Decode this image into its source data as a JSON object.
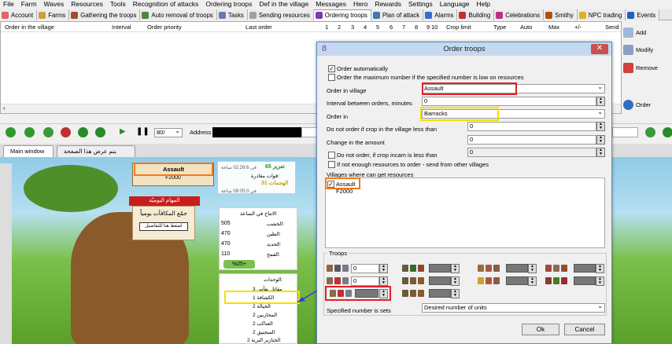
{
  "menu": [
    "File",
    "Farm",
    "Waves",
    "Resources",
    "Tools",
    "Recognition of attacks",
    "Ordering troops",
    "Def in the village",
    "Messages",
    "Hero",
    "Rewards",
    "Settings",
    "Language",
    "Help"
  ],
  "tabs": [
    "Account",
    "Farms",
    "Gathering the troops",
    "Auto removal of troops",
    "Tasks",
    "Sending resources",
    "Ordering troops",
    "Plan of attack",
    "Alarms",
    "Building",
    "Celebrations",
    "Smithy",
    "NPC trading",
    "Events"
  ],
  "orders_table": {
    "columns": [
      "Order in the village",
      "Interval",
      "Order priority",
      "Last order",
      "1",
      "2",
      "3",
      "4",
      "5",
      "6",
      "7",
      "8",
      "9",
      "10",
      "Crop limit",
      "Type",
      "Auto",
      "Max",
      "+/-",
      "Send"
    ]
  },
  "side_buttons": {
    "add": "Add",
    "modify": "Modify",
    "remove": "Remove",
    "order": "Order"
  },
  "toolbar": {
    "zoom": "80/",
    "address_label": "Address"
  },
  "browser_tabs": [
    "Main window",
    "يتم عرض هذا الصفحة"
  ],
  "dialog": {
    "title": "Order troops",
    "close": "✕",
    "order_automatically": "Order automatically",
    "order_max": "Order the maximum number if the specified number is low on resources",
    "order_in_village_label": "Order in village",
    "order_in_village_value": "Assault",
    "interval_label": "Interval between orders, minutes",
    "interval_value": "0",
    "order_in_label": "Order in",
    "order_in_value": "Barracks",
    "crop_label": "Do not order if crop in the village less than",
    "crop_value": "0",
    "change_label": "Change in the amount",
    "change_value": "0",
    "incam_label": "Do not order, if crop incam is less than",
    "incam_value": "0",
    "not_enough_label": "If not enough resources to order - send from other villages",
    "villages_label": "Villages where can get resources",
    "villages": [
      "Assault",
      "F2000"
    ],
    "troops_label": "Troops",
    "troop_values": [
      "0",
      "0"
    ],
    "specified_label": "Specified number is sets",
    "specified_value": "Desired number of units",
    "ok": "Ok",
    "cancel": "Cancel"
  },
  "game": {
    "village_name": "Assault",
    "village_alt": "F2000",
    "daily_tasks": "المهام اليوميّة",
    "daily_reward": "جمّع المكافآت يومياً",
    "details_btn": "اضغط هنا للتفاصيل",
    "attack1": "65 تعزيز",
    "attack1_time": "في 02:26:6 ساعة",
    "incoming": "قوات مغادرة:",
    "attack2": "31 الهجمات",
    "attack2_time": "في 08:05:0 ساعة",
    "production_title": "الانتاج في الساعة",
    "res_wood_label": "الخشب:",
    "res_wood": "505",
    "res_clay_label": "الطين:",
    "res_clay": "470",
    "res_iron_label": "الحديد:",
    "res_iron": "470",
    "res_crop_label": "القمح:",
    "res_crop": "110",
    "bonus": "%25+",
    "units_title": "الوحدات:",
    "units": [
      "3 مقاتل بفأس",
      "1 الكشافة",
      "2 الخيالة",
      "2 المحاربين",
      "2 العناكب",
      "2 المنجنيق",
      "2 الخنازير البرية"
    ]
  }
}
